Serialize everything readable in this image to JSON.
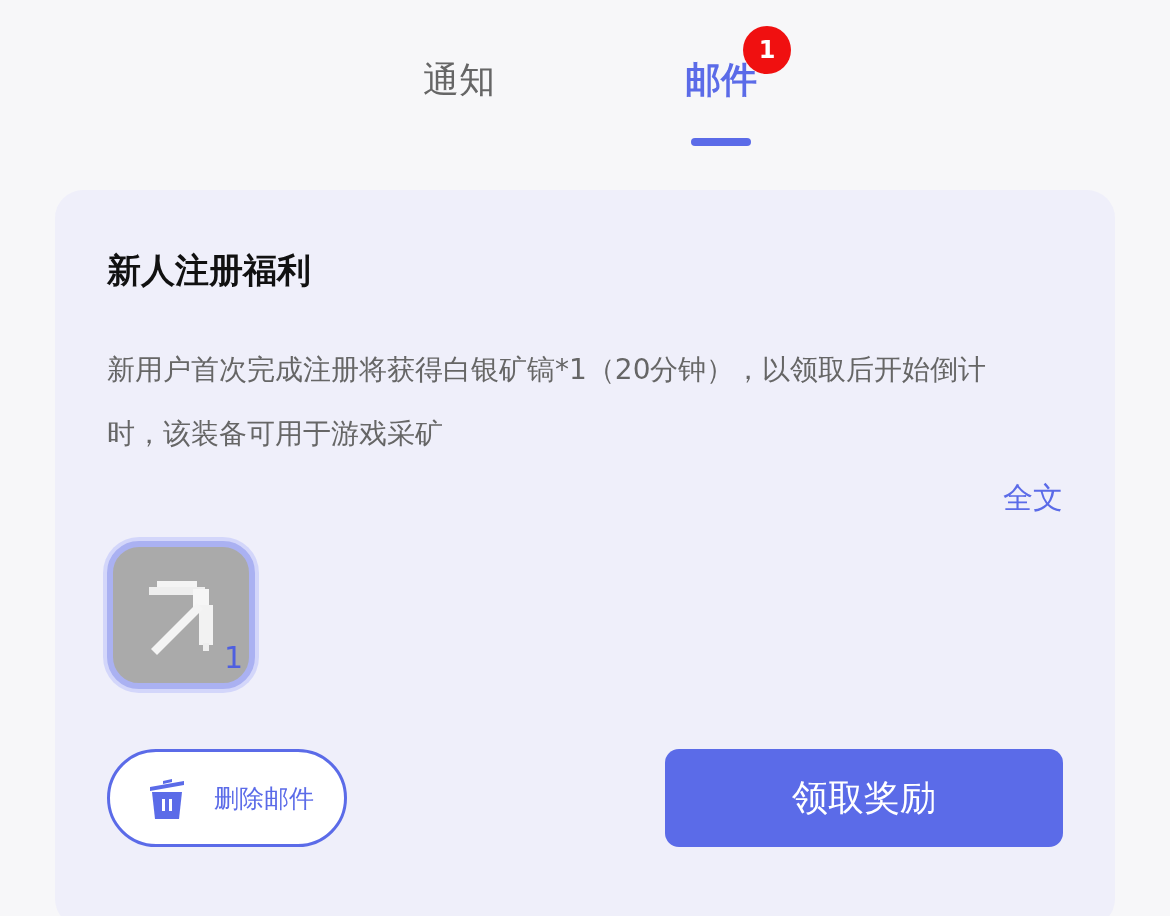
{
  "tabs": [
    {
      "label": "通知",
      "selected": false
    },
    {
      "label": "邮件",
      "selected": true,
      "badge": "1"
    }
  ],
  "mail": {
    "title": "新人注册福利",
    "body": "新用户首次完成注册将获得白银矿镐*1（20分钟），以领取后开始倒计时，该装备可用于游戏采矿",
    "more_link": "全文",
    "attachments": [
      {
        "count": "1",
        "selected": true
      }
    ],
    "delete_button": "删除邮件",
    "claim_button": "领取奖励"
  }
}
